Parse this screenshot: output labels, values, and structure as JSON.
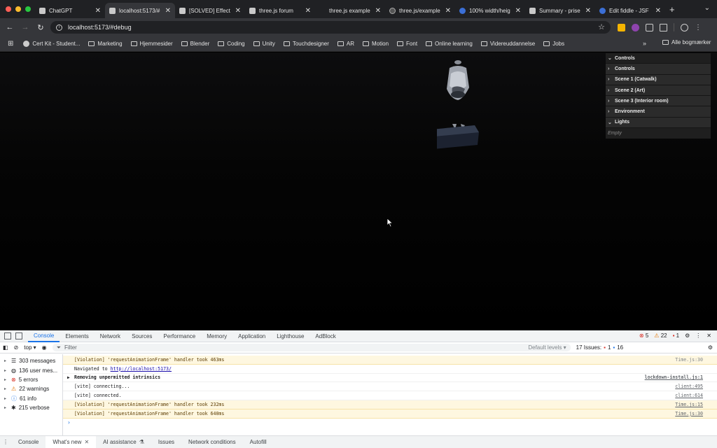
{
  "browser": {
    "tabs": [
      {
        "label": "ChatGPT",
        "icon": "chatgpt-icon"
      },
      {
        "label": "localhost:5173/#",
        "icon": "page-icon"
      },
      {
        "label": "[SOLVED] Effect",
        "icon": "page-icon"
      },
      {
        "label": "three.js forum",
        "icon": "page-icon"
      },
      {
        "label": "three.js example",
        "icon": "page-icon"
      },
      {
        "label": "three.js/example",
        "icon": "github-icon"
      },
      {
        "label": "100% width/heig",
        "icon": "page-icon"
      },
      {
        "label": "Summary - prise",
        "icon": "page-icon"
      },
      {
        "label": "Edit fiddle - JSF",
        "icon": "page-icon"
      }
    ],
    "new_tab": "+",
    "url": "localhost:5173/#debug",
    "bookmarks": [
      {
        "label": "Cert Kit - Student...",
        "type": "site"
      },
      {
        "label": "Marketing",
        "type": "folder"
      },
      {
        "label": "Hjemmesider",
        "type": "folder"
      },
      {
        "label": "Blender",
        "type": "folder"
      },
      {
        "label": "Coding",
        "type": "folder"
      },
      {
        "label": "Unity",
        "type": "folder"
      },
      {
        "label": "Touchdesigner",
        "type": "folder"
      },
      {
        "label": "AR",
        "type": "folder"
      },
      {
        "label": "Motion",
        "type": "folder"
      },
      {
        "label": "Font",
        "type": "folder"
      },
      {
        "label": "Online learning",
        "type": "folder"
      },
      {
        "label": "Videreuddannelse",
        "type": "folder"
      },
      {
        "label": "Jobs",
        "type": "folder"
      }
    ],
    "bookmarks_more": "»",
    "all_bookmarks": "Alle bogmærker"
  },
  "gui": {
    "title": "Controls",
    "items": [
      {
        "label": "Controls",
        "expanded": false
      },
      {
        "label": "Scene 1 (Catwalk)",
        "expanded": false
      },
      {
        "label": "Scene 2 (Art)",
        "expanded": false
      },
      {
        "label": "Scene 3 (Interior room)",
        "expanded": false
      },
      {
        "label": "Environment",
        "expanded": false
      },
      {
        "label": "Lights",
        "expanded": true
      }
    ],
    "empty_label": "Empty"
  },
  "devtools": {
    "tabs": [
      "Console",
      "Elements",
      "Network",
      "Sources",
      "Performance",
      "Memory",
      "Application",
      "Lighthouse",
      "AdBlock"
    ],
    "active_tab": "Console",
    "errors": "5",
    "warnings": "22",
    "infos": "1",
    "context": "top",
    "filter_placeholder": "Filter",
    "levels": "Default levels",
    "issues_label": "17 Issues:",
    "issues_errors": "1",
    "issues_info": "16",
    "sidebar": [
      {
        "label": "303 messages",
        "icon": "list-icon"
      },
      {
        "label": "136 user mes...",
        "icon": "user-icon"
      },
      {
        "label": "5 errors",
        "icon": "error-icon"
      },
      {
        "label": "22 warnings",
        "icon": "warning-icon"
      },
      {
        "label": "61 info",
        "icon": "info-icon"
      },
      {
        "label": "215 verbose",
        "icon": "bug-icon"
      }
    ],
    "log": [
      {
        "text": "[Violation] 'requestAnimationFrame' handler took 463ms",
        "source": "Time.js:30",
        "kind": "warn"
      },
      {
        "text": "Navigated to",
        "link": "http://localhost:5173/",
        "source": "",
        "kind": "nav"
      },
      {
        "text": "Removing unpermitted intrinsics",
        "source": "lockdown-install.js:1",
        "kind": "bold"
      },
      {
        "text": "[vite] connecting...",
        "source": "client:495",
        "kind": "plain"
      },
      {
        "text": "[vite] connected.",
        "source": "client:614",
        "kind": "plain"
      },
      {
        "text": "[Violation] 'requestAnimationFrame' handler took 232ms",
        "source": "Time.js:15",
        "kind": "warn"
      },
      {
        "text": "[Violation] 'requestAnimationFrame' handler took 640ms",
        "source": "Time.js:30",
        "kind": "warn"
      }
    ],
    "drawer_tabs": [
      "Console",
      "What's new",
      "AI assistance",
      "Issues",
      "Network conditions",
      "Autofill"
    ],
    "drawer_active": "What's new"
  }
}
